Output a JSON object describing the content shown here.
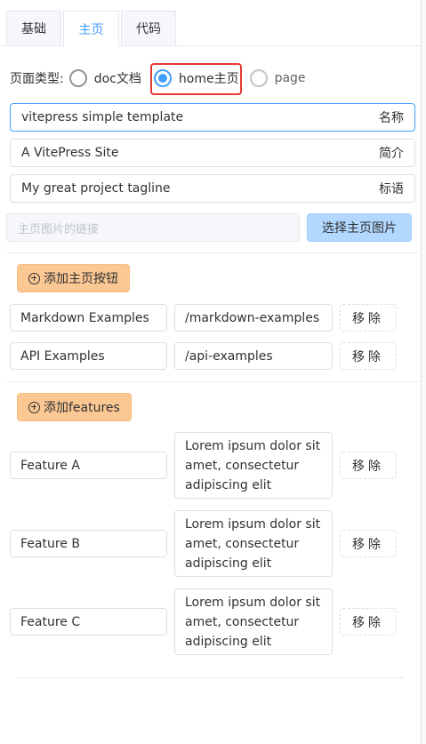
{
  "tabs": [
    {
      "label": "基础",
      "active": false
    },
    {
      "label": "主页",
      "active": true
    },
    {
      "label": "代码",
      "active": false
    }
  ],
  "page_type": {
    "label": "页面类型:",
    "options": [
      {
        "label": "doc文档",
        "selected": false
      },
      {
        "label": "home主页",
        "selected": true
      },
      {
        "label": "page",
        "selected": false
      }
    ]
  },
  "fields": {
    "name": {
      "value": "vitepress simple template",
      "suffix": "名称"
    },
    "desc": {
      "value": "A VitePress Site",
      "suffix": "简介"
    },
    "tagline": {
      "value": "My great project tagline",
      "suffix": "标语"
    }
  },
  "hero_image": {
    "placeholder": "主页图片的链接",
    "button": "选择主页图片"
  },
  "actions": {
    "add_label": "添加主页按钮",
    "items": [
      {
        "text": "Markdown Examples",
        "link": "/markdown-examples",
        "remove": "移除"
      },
      {
        "text": "API Examples",
        "link": "/api-examples",
        "remove": "移除"
      }
    ]
  },
  "features": {
    "add_label": "添加features",
    "items": [
      {
        "title": "Feature A",
        "details": "Lorem ipsum dolor sit amet, consectetur adipiscing elit",
        "remove": "移除"
      },
      {
        "title": "Feature B",
        "details": "Lorem ipsum dolor sit amet, consectetur adipiscing elit",
        "remove": "移除"
      },
      {
        "title": "Feature C",
        "details": "Lorem ipsum dolor sit amet, consectetur adipiscing elit",
        "remove": "移除"
      }
    ]
  },
  "colors": {
    "primary": "#409eff",
    "warning_light": "#fbc793",
    "highlight": "#e53935"
  }
}
